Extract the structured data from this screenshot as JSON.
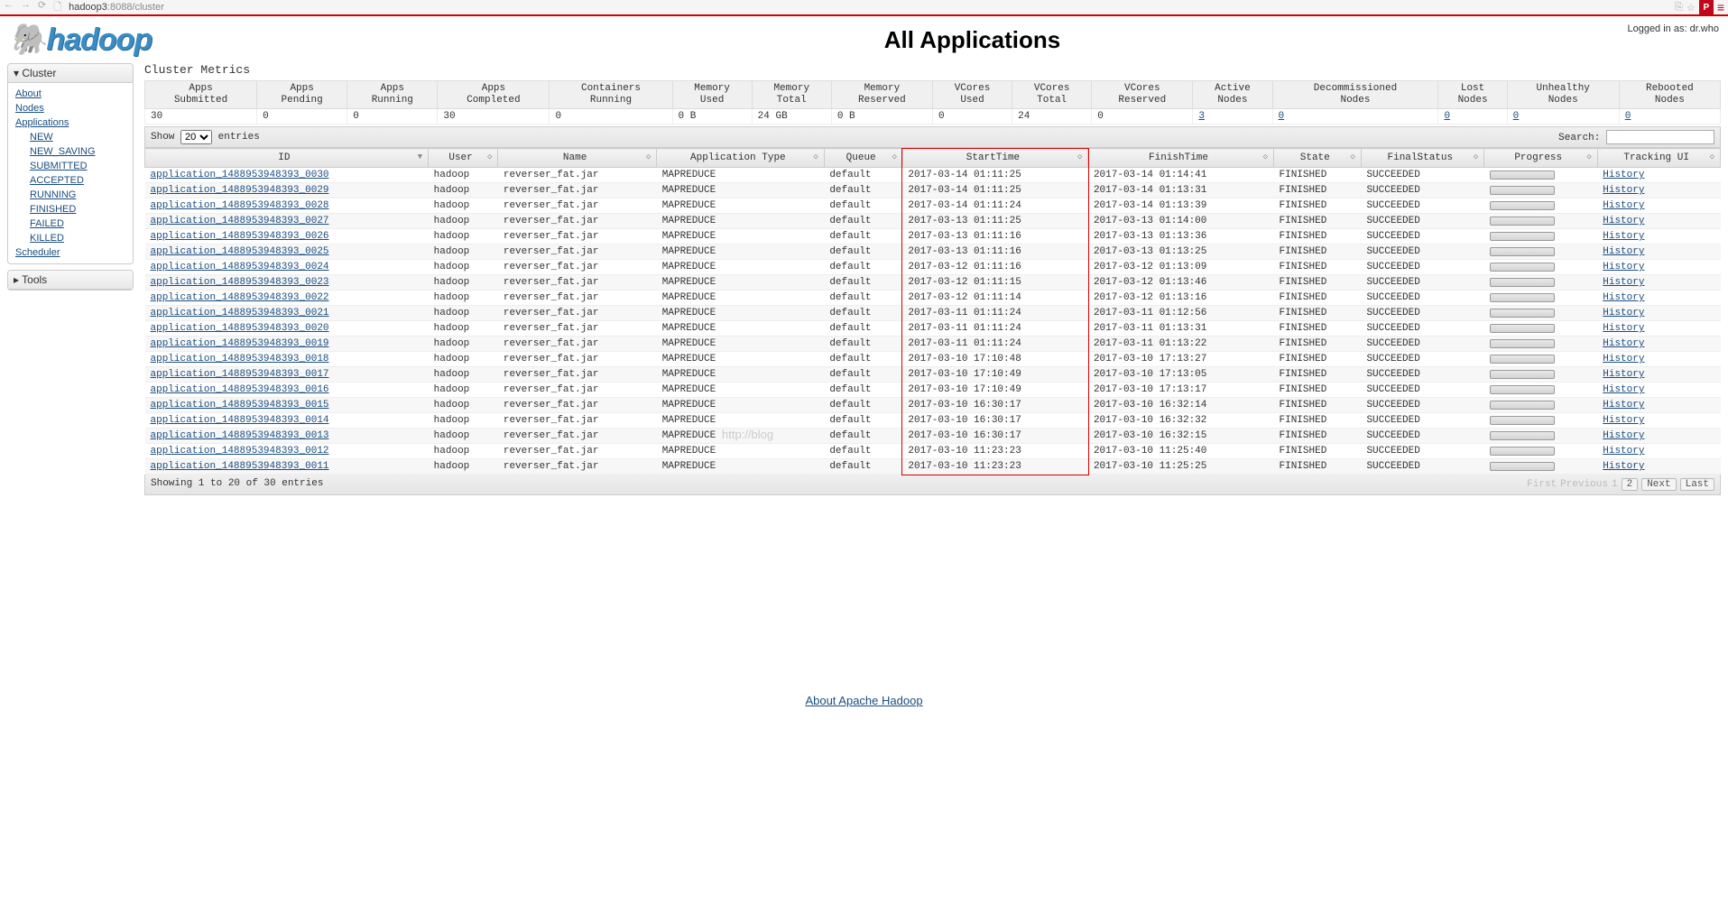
{
  "browser": {
    "url_host": "hadoop3",
    "url_rest": ":8088/cluster"
  },
  "login_text": "Logged in as: dr.who",
  "page_title": "All Applications",
  "sidebar": {
    "cluster_label": "Cluster",
    "tools_label": "Tools",
    "links": {
      "about": "About",
      "nodes": "Nodes",
      "applications": "Applications",
      "scheduler": "Scheduler"
    },
    "app_states": [
      "NEW",
      "NEW_SAVING",
      "SUBMITTED",
      "ACCEPTED",
      "RUNNING",
      "FINISHED",
      "FAILED",
      "KILLED"
    ]
  },
  "metrics": {
    "section_title": "Cluster Metrics",
    "headers": [
      "Apps Submitted",
      "Apps Pending",
      "Apps Running",
      "Apps Completed",
      "Containers Running",
      "Memory Used",
      "Memory Total",
      "Memory Reserved",
      "VCores Used",
      "VCores Total",
      "VCores Reserved",
      "Active Nodes",
      "Decommissioned Nodes",
      "Lost Nodes",
      "Unhealthy Nodes",
      "Rebooted Nodes"
    ],
    "values": [
      "30",
      "0",
      "0",
      "30",
      "0",
      "0 B",
      "24 GB",
      "0 B",
      "0",
      "24",
      "0",
      "3",
      "0",
      "0",
      "0",
      "0"
    ],
    "link_cols": [
      11,
      12,
      13,
      14,
      15
    ]
  },
  "controls": {
    "show_label": "Show",
    "show_value": "20",
    "entries_label": "entries",
    "search_label": "Search:",
    "search_value": ""
  },
  "app_table": {
    "headers": [
      "ID",
      "User",
      "Name",
      "Application Type",
      "Queue",
      "StartTime",
      "FinishTime",
      "State",
      "FinalStatus",
      "Progress",
      "Tracking UI"
    ],
    "sort_col": 0,
    "rows": [
      {
        "id": "application_1488953948393_0030",
        "user": "hadoop",
        "name": "reverser_fat.jar",
        "type": "MAPREDUCE",
        "queue": "default",
        "start": "2017-03-14 01:11:25",
        "finish": "2017-03-14 01:14:41",
        "state": "FINISHED",
        "final": "SUCCEEDED",
        "track": "History"
      },
      {
        "id": "application_1488953948393_0029",
        "user": "hadoop",
        "name": "reverser_fat.jar",
        "type": "MAPREDUCE",
        "queue": "default",
        "start": "2017-03-14 01:11:25",
        "finish": "2017-03-14 01:13:31",
        "state": "FINISHED",
        "final": "SUCCEEDED",
        "track": "History"
      },
      {
        "id": "application_1488953948393_0028",
        "user": "hadoop",
        "name": "reverser_fat.jar",
        "type": "MAPREDUCE",
        "queue": "default",
        "start": "2017-03-14 01:11:24",
        "finish": "2017-03-14 01:13:39",
        "state": "FINISHED",
        "final": "SUCCEEDED",
        "track": "History"
      },
      {
        "id": "application_1488953948393_0027",
        "user": "hadoop",
        "name": "reverser_fat.jar",
        "type": "MAPREDUCE",
        "queue": "default",
        "start": "2017-03-13 01:11:25",
        "finish": "2017-03-13 01:14:00",
        "state": "FINISHED",
        "final": "SUCCEEDED",
        "track": "History"
      },
      {
        "id": "application_1488953948393_0026",
        "user": "hadoop",
        "name": "reverser_fat.jar",
        "type": "MAPREDUCE",
        "queue": "default",
        "start": "2017-03-13 01:11:16",
        "finish": "2017-03-13 01:13:36",
        "state": "FINISHED",
        "final": "SUCCEEDED",
        "track": "History"
      },
      {
        "id": "application_1488953948393_0025",
        "user": "hadoop",
        "name": "reverser_fat.jar",
        "type": "MAPREDUCE",
        "queue": "default",
        "start": "2017-03-13 01:11:16",
        "finish": "2017-03-13 01:13:25",
        "state": "FINISHED",
        "final": "SUCCEEDED",
        "track": "History"
      },
      {
        "id": "application_1488953948393_0024",
        "user": "hadoop",
        "name": "reverser_fat.jar",
        "type": "MAPREDUCE",
        "queue": "default",
        "start": "2017-03-12 01:11:16",
        "finish": "2017-03-12 01:13:09",
        "state": "FINISHED",
        "final": "SUCCEEDED",
        "track": "History"
      },
      {
        "id": "application_1488953948393_0023",
        "user": "hadoop",
        "name": "reverser_fat.jar",
        "type": "MAPREDUCE",
        "queue": "default",
        "start": "2017-03-12 01:11:15",
        "finish": "2017-03-12 01:13:46",
        "state": "FINISHED",
        "final": "SUCCEEDED",
        "track": "History"
      },
      {
        "id": "application_1488953948393_0022",
        "user": "hadoop",
        "name": "reverser_fat.jar",
        "type": "MAPREDUCE",
        "queue": "default",
        "start": "2017-03-12 01:11:14",
        "finish": "2017-03-12 01:13:16",
        "state": "FINISHED",
        "final": "SUCCEEDED",
        "track": "History"
      },
      {
        "id": "application_1488953948393_0021",
        "user": "hadoop",
        "name": "reverser_fat.jar",
        "type": "MAPREDUCE",
        "queue": "default",
        "start": "2017-03-11 01:11:24",
        "finish": "2017-03-11 01:12:56",
        "state": "FINISHED",
        "final": "SUCCEEDED",
        "track": "History"
      },
      {
        "id": "application_1488953948393_0020",
        "user": "hadoop",
        "name": "reverser_fat.jar",
        "type": "MAPREDUCE",
        "queue": "default",
        "start": "2017-03-11 01:11:24",
        "finish": "2017-03-11 01:13:31",
        "state": "FINISHED",
        "final": "SUCCEEDED",
        "track": "History"
      },
      {
        "id": "application_1488953948393_0019",
        "user": "hadoop",
        "name": "reverser_fat.jar",
        "type": "MAPREDUCE",
        "queue": "default",
        "start": "2017-03-11 01:11:24",
        "finish": "2017-03-11 01:13:22",
        "state": "FINISHED",
        "final": "SUCCEEDED",
        "track": "History"
      },
      {
        "id": "application_1488953948393_0018",
        "user": "hadoop",
        "name": "reverser_fat.jar",
        "type": "MAPREDUCE",
        "queue": "default",
        "start": "2017-03-10 17:10:48",
        "finish": "2017-03-10 17:13:27",
        "state": "FINISHED",
        "final": "SUCCEEDED",
        "track": "History"
      },
      {
        "id": "application_1488953948393_0017",
        "user": "hadoop",
        "name": "reverser_fat.jar",
        "type": "MAPREDUCE",
        "queue": "default",
        "start": "2017-03-10 17:10:49",
        "finish": "2017-03-10 17:13:05",
        "state": "FINISHED",
        "final": "SUCCEEDED",
        "track": "History"
      },
      {
        "id": "application_1488953948393_0016",
        "user": "hadoop",
        "name": "reverser_fat.jar",
        "type": "MAPREDUCE",
        "queue": "default",
        "start": "2017-03-10 17:10:49",
        "finish": "2017-03-10 17:13:17",
        "state": "FINISHED",
        "final": "SUCCEEDED",
        "track": "History"
      },
      {
        "id": "application_1488953948393_0015",
        "user": "hadoop",
        "name": "reverser_fat.jar",
        "type": "MAPREDUCE",
        "queue": "default",
        "start": "2017-03-10 16:30:17",
        "finish": "2017-03-10 16:32:14",
        "state": "FINISHED",
        "final": "SUCCEEDED",
        "track": "History"
      },
      {
        "id": "application_1488953948393_0014",
        "user": "hadoop",
        "name": "reverser_fat.jar",
        "type": "MAPREDUCE",
        "queue": "default",
        "start": "2017-03-10 16:30:17",
        "finish": "2017-03-10 16:32:32",
        "state": "FINISHED",
        "final": "SUCCEEDED",
        "track": "History"
      },
      {
        "id": "application_1488953948393_0013",
        "user": "hadoop",
        "name": "reverser_fat.jar",
        "type": "MAPREDUCE",
        "queue": "default",
        "start": "2017-03-10 16:30:17",
        "finish": "2017-03-10 16:32:15",
        "state": "FINISHED",
        "final": "SUCCEEDED",
        "track": "History"
      },
      {
        "id": "application_1488953948393_0012",
        "user": "hadoop",
        "name": "reverser_fat.jar",
        "type": "MAPREDUCE",
        "queue": "default",
        "start": "2017-03-10 11:23:23",
        "finish": "2017-03-10 11:25:40",
        "state": "FINISHED",
        "final": "SUCCEEDED",
        "track": "History"
      },
      {
        "id": "application_1488953948393_0011",
        "user": "hadoop",
        "name": "reverser_fat.jar",
        "type": "MAPREDUCE",
        "queue": "default",
        "start": "2017-03-10 11:23:23",
        "finish": "2017-03-10 11:25:25",
        "state": "FINISHED",
        "final": "SUCCEEDED",
        "track": "History"
      }
    ]
  },
  "footer": {
    "info": "Showing 1 to 20 of 30 entries",
    "first": "First",
    "prev": "Previous",
    "p1": "1",
    "p2": "2",
    "next": "Next",
    "last": "Last"
  },
  "watermark": "http://blog",
  "about_link": "About Apache Hadoop"
}
